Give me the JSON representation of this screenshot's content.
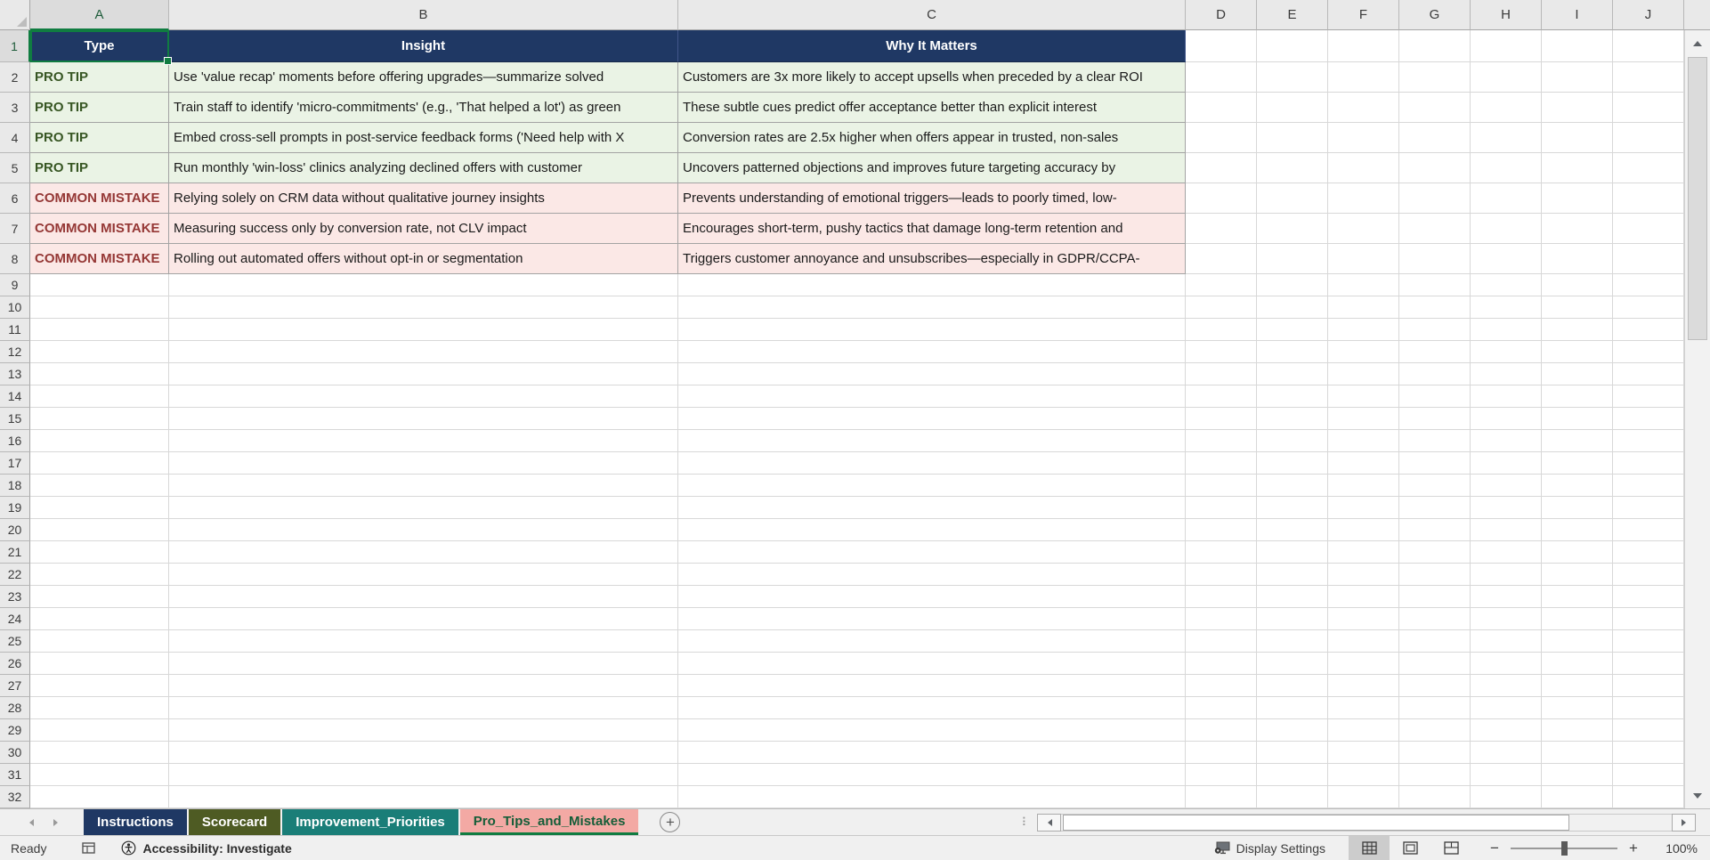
{
  "sheet": {
    "columns": [
      "A",
      "B",
      "C",
      "D",
      "E",
      "F",
      "G",
      "H",
      "I",
      "J"
    ],
    "visible_row_count": 32,
    "selection": "A1",
    "header_row": [
      "Type",
      "Insight",
      "Why It Matters"
    ],
    "rows": [
      {
        "row": 2,
        "kind": "tip",
        "type": "PRO TIP",
        "insight": "Use 'value recap' moments before offering upgrades—summarize solved",
        "why": "Customers are 3x more likely to accept upsells when preceded by a clear ROI"
      },
      {
        "row": 3,
        "kind": "tip",
        "type": "PRO TIP",
        "insight": "Train staff to identify 'micro-commitments' (e.g., 'That helped a lot') as green",
        "why": "These subtle cues predict offer acceptance better than explicit interest"
      },
      {
        "row": 4,
        "kind": "tip",
        "type": "PRO TIP",
        "insight": "Embed cross-sell prompts in post-service feedback forms ('Need help with X",
        "why": "Conversion rates are 2.5x higher when offers appear in trusted, non-sales"
      },
      {
        "row": 5,
        "kind": "tip",
        "type": "PRO TIP",
        "insight": "Run monthly 'win-loss' clinics analyzing declined offers with customer",
        "why": "Uncovers patterned objections and improves future targeting accuracy by"
      },
      {
        "row": 6,
        "kind": "mistake",
        "type": "COMMON MISTAKE",
        "insight": "Relying solely on CRM data without qualitative journey insights",
        "why": "Prevents understanding of emotional triggers—leads to poorly timed, low-"
      },
      {
        "row": 7,
        "kind": "mistake",
        "type": "COMMON MISTAKE",
        "insight": "Measuring success only by conversion rate, not CLV impact",
        "why": "Encourages short-term, pushy tactics that damage long-term retention and"
      },
      {
        "row": 8,
        "kind": "mistake",
        "type": "COMMON MISTAKE",
        "insight": "Rolling out automated offers without opt-in or segmentation",
        "why": "Triggers customer annoyance and unsubscribes—especially in GDPR/CCPA-"
      }
    ]
  },
  "tabs": [
    {
      "label": "Instructions",
      "color": "#1F3864",
      "active": false
    },
    {
      "label": "Scorecard",
      "color": "#4E5B23",
      "active": false
    },
    {
      "label": "Improvement_Priorities",
      "color": "#1A7E78",
      "active": false
    },
    {
      "label": "Pro_Tips_and_Mistakes",
      "color": "#F3A9A4",
      "active": true
    }
  ],
  "tab_bar": {
    "add_sheet_label": "+"
  },
  "status_bar": {
    "ready": "Ready",
    "accessibility": "Accessibility: Investigate",
    "display_settings": "Display Settings",
    "zoom_level": "100%"
  },
  "colors": {
    "header_fill": "#1F3864",
    "tip_fill": "#EAF3E5",
    "tip_text": "#375623",
    "mistake_fill": "#FBE8E6",
    "mistake_text": "#953735",
    "selection_green": "#107C41",
    "active_tab_fill": "#F3A9A4",
    "active_tab_text": "#155D38"
  }
}
